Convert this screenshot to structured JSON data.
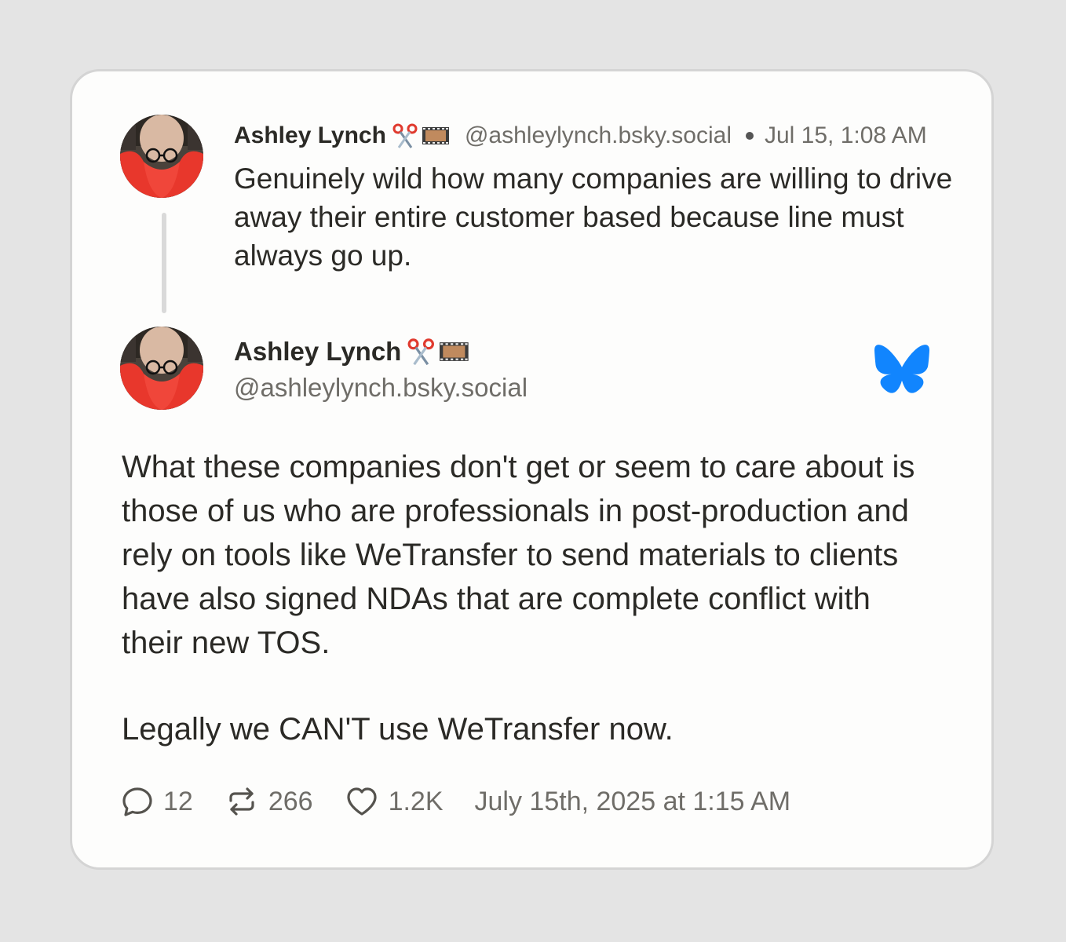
{
  "parent_post": {
    "author_name": "Ashley Lynch",
    "author_emoji": "✂️🎞️",
    "handle": "@ashleylynch.bsky.social",
    "separator": "•",
    "timestamp": "Jul 15, 1:08 AM",
    "text": "Genuinely wild how many companies are willing to drive away their entire customer based because line must always go up."
  },
  "main_post": {
    "author_name": "Ashley Lynch",
    "author_emoji": "✂️🎞️",
    "handle": "@ashleylynch.bsky.social",
    "paragraphs": [
      "What these companies don't get or seem to care about is those of us who are professionals in post-production and rely on tools like WeTransfer to send materials to clients have also signed NDAs that are complete conflict with their new TOS.",
      "Legally we CAN'T use WeTransfer now."
    ],
    "replies": "12",
    "reposts": "266",
    "likes": "1.2K",
    "full_timestamp": "July 15th, 2025 at 1:15 AM"
  },
  "icons": {
    "reply": "speech-bubble-icon",
    "repost": "repost-arrows-icon",
    "like": "heart-icon",
    "brand": "bluesky-butterfly-logo"
  },
  "colors": {
    "brand_blue": "#1185fe",
    "avatar_hair": "#e8372c"
  }
}
